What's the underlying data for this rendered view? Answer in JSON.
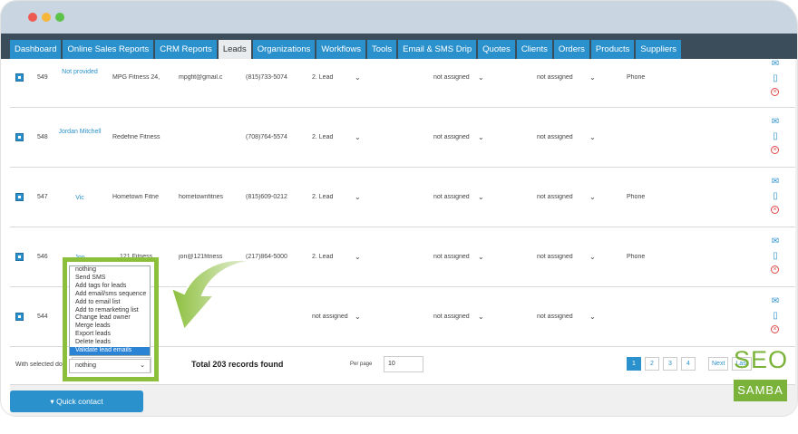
{
  "nav": {
    "tabs": [
      {
        "label": "Dashboard"
      },
      {
        "label": "Online Sales Reports"
      },
      {
        "label": "CRM Reports"
      },
      {
        "label": "Leads"
      },
      {
        "label": "Organizations"
      },
      {
        "label": "Workflows"
      },
      {
        "label": "Tools"
      },
      {
        "label": "Email & SMS Drip"
      },
      {
        "label": "Quotes"
      },
      {
        "label": "Clients"
      },
      {
        "label": "Orders"
      },
      {
        "label": "Products"
      },
      {
        "label": "Suppliers"
      }
    ],
    "active_tab": "Leads"
  },
  "rows": [
    {
      "id": "549",
      "name": "Not provided",
      "company": "MPG Fitness 24,",
      "email": "mpgfit@gmail.c",
      "phone": "(815)733-5074",
      "status": "2. Lead",
      "assigned1": "not assigned",
      "assigned2": "not assigned",
      "source": "Phone"
    },
    {
      "id": "548",
      "name": "Jordan Mitchell",
      "company": "Redefine Fitness",
      "email": "",
      "phone": "(708)764-5574",
      "status": "2. Lead",
      "assigned1": "not assigned",
      "assigned2": "not assigned",
      "source": ""
    },
    {
      "id": "547",
      "name": "Vic",
      "company": "Hometown Fitne",
      "email": "hometownfitnes",
      "phone": "(815)609-0212",
      "status": "2. Lead",
      "assigned1": "not assigned",
      "assigned2": "not assigned",
      "source": "Phone"
    },
    {
      "id": "546",
      "name": "Jon",
      "company": "121 Fitness",
      "email": "jon@121fitness",
      "phone": "(217)864-5000",
      "status": "2. Lead",
      "assigned1": "not assigned",
      "assigned2": "not assigned",
      "source": "Phone"
    },
    {
      "id": "544",
      "name": "",
      "company": "",
      "email": "",
      "phone": "",
      "status": "not assigned",
      "assigned1": "not assigned",
      "assigned2": "not assigned",
      "source": ""
    }
  ],
  "footer": {
    "with_selected": "With selected do",
    "select_value": "nothing",
    "total": "Total 203 records found",
    "per_page_label": "Per page",
    "per_page_value": "10",
    "pages": [
      "1",
      "2",
      "3",
      "4",
      "Next",
      "Last"
    ]
  },
  "bulk_actions": {
    "options": [
      "nothing",
      "Send SMS",
      "Add tags for leads",
      "Add email/sms sequence",
      "Add to email list",
      "Add to remarketing list",
      "Change lead owner",
      "Merge leads",
      "Export leads",
      "Delete leads",
      "Validate lead emails"
    ],
    "highlighted": "Validate lead emails",
    "current": "nothing"
  },
  "quick_contact": {
    "label": "Quick contact"
  },
  "logo": {
    "line1": "SEO",
    "line2": "SAMBA"
  },
  "colors": {
    "accent": "#2b91cc",
    "nav_bg": "#3b4d5a",
    "highlight": "#8bbf3c"
  }
}
